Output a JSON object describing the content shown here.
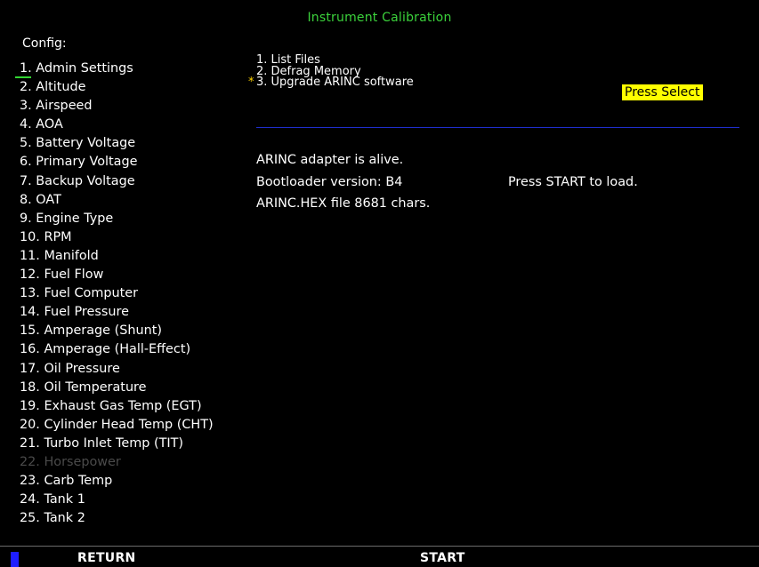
{
  "title": "Instrument Calibration",
  "config": {
    "label": "Config:",
    "items": [
      {
        "label": "1. Admin Settings",
        "state": "selected"
      },
      {
        "label": "2. Altitude",
        "state": "normal"
      },
      {
        "label": "3. Airspeed",
        "state": "normal"
      },
      {
        "label": "4. AOA",
        "state": "normal"
      },
      {
        "label": "5. Battery Voltage",
        "state": "normal"
      },
      {
        "label": "6. Primary Voltage",
        "state": "normal"
      },
      {
        "label": "7. Backup Voltage",
        "state": "normal"
      },
      {
        "label": "8. OAT",
        "state": "normal"
      },
      {
        "label": "9. Engine Type",
        "state": "normal"
      },
      {
        "label": "10. RPM",
        "state": "normal"
      },
      {
        "label": "11. Manifold",
        "state": "normal"
      },
      {
        "label": "12. Fuel Flow",
        "state": "normal"
      },
      {
        "label": "13. Fuel Computer",
        "state": "normal"
      },
      {
        "label": "14. Fuel Pressure",
        "state": "normal"
      },
      {
        "label": "15. Amperage (Shunt)",
        "state": "normal"
      },
      {
        "label": "16. Amperage (Hall-Effect)",
        "state": "normal"
      },
      {
        "label": "17. Oil Pressure",
        "state": "normal"
      },
      {
        "label": "18. Oil Temperature",
        "state": "normal"
      },
      {
        "label": "19. Exhaust Gas Temp (EGT)",
        "state": "normal"
      },
      {
        "label": "20. Cylinder Head Temp (CHT)",
        "state": "normal"
      },
      {
        "label": "21. Turbo Inlet Temp (TIT)",
        "state": "normal"
      },
      {
        "label": "22. Horsepower",
        "state": "disabled"
      },
      {
        "label": "23. Carb Temp",
        "state": "normal"
      },
      {
        "label": "24. Tank 1",
        "state": "normal"
      },
      {
        "label": "25. Tank 2",
        "state": "normal"
      }
    ]
  },
  "menu": {
    "items": [
      {
        "label": "1. List Files",
        "marked": false
      },
      {
        "label": "2. Defrag Memory",
        "marked": false
      },
      {
        "label": "3. Upgrade ARINC software",
        "marked": true
      }
    ],
    "marker": "*",
    "press_select": "Press Select"
  },
  "status": {
    "adapter": "ARINC adapter is alive.",
    "bootloader": "Bootloader version: B4",
    "file": "ARINC.HEX  file 8681 chars.",
    "prompt": "Press START to load."
  },
  "softkeys": {
    "return_label": "RETURN",
    "start_label": "START"
  },
  "colors": {
    "title": "#3bd13b",
    "highlight": "#ffff00",
    "divider": "#1f2ecc",
    "disabled": "#4a4a4a",
    "marker": "#1e1eff"
  }
}
